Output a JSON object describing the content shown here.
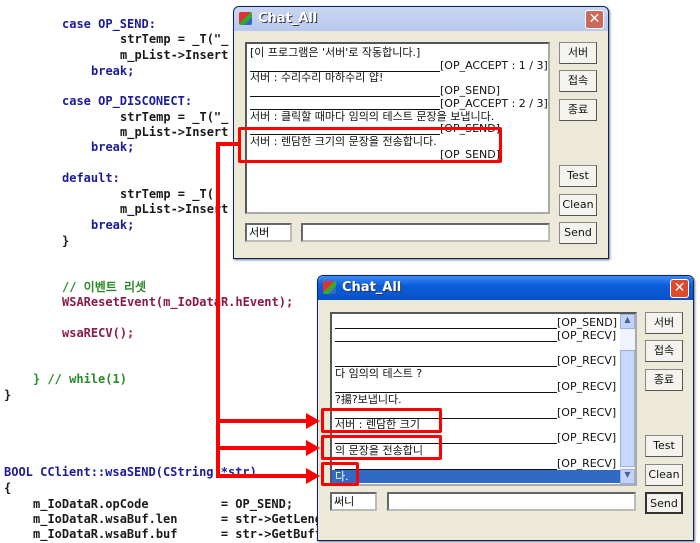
{
  "code": [
    {
      "text": "case OP_SEND:",
      "parts": [
        "case ",
        "OP_SEND",
        ":"
      ]
    },
    {
      "text": "strTemp = _T(\"_"
    },
    {
      "text": "m_pList->Insert"
    },
    {
      "text": "break;"
    },
    {
      "text": "case OP_DISCONECT:"
    },
    {
      "text": "strTemp = _T(\"_"
    },
    {
      "text": "m_pList->Insert"
    },
    {
      "text": "break;"
    },
    {
      "text": "default:"
    },
    {
      "text": "strTemp = _T("
    },
    {
      "text": "m_pList->Insert"
    },
    {
      "text": "break;"
    },
    {
      "text": "}"
    },
    {
      "text": "// 이벤트 리셋"
    },
    {
      "text": "WSAResetEvent(m_IoDataR.hEvent);"
    },
    {
      "text": "wsaRECV();"
    },
    {
      "text": "} // while(1)"
    },
    {
      "text": "}"
    },
    {
      "text": "BOOL CClient::wsaSEND(CString *str)"
    },
    {
      "text": "{"
    },
    {
      "text": "m_IoDataR.opCode          = OP_SEND;"
    },
    {
      "text": "m_IoDataR.wsaBuf.len      = str->GetLeng"
    },
    {
      "text": "m_IoDataR.wsaBuf.buf      = str->GetBuffer();"
    }
  ],
  "window1": {
    "title": "Chat_All",
    "rows": [
      {
        "text": "[이 프로그램은 '서버'로 작동합니다.]"
      },
      {
        "tag": "[OP_ACCEPT : 1 / 3]"
      },
      {
        "text": "서버 : 수리수리 마하수리 얍!"
      },
      {
        "tag": "[OP_SEND]"
      },
      {
        "tag": "[OP_ACCEPT : 2 / 3]"
      },
      {
        "text": "서버 : 클릭할 때마다 임의의 테스트 문장을 보냅니다."
      },
      {
        "tag": "[OP_SEND]"
      },
      {
        "text": "서버 : 렌담한 크기의 문장을 전송합니다."
      },
      {
        "tag": "[OP_SEND]"
      }
    ],
    "buttons": {
      "server": "서버",
      "connect": "접속",
      "exit": "종료",
      "test": "Test",
      "clean": "Clean",
      "send": "Send"
    },
    "name_value": "서버",
    "message_value": ""
  },
  "window2": {
    "title": "Chat_All",
    "rows": [
      {
        "tag": "[OP_SEND]"
      },
      {
        "tag": "[OP_RECV]"
      },
      {
        "text": ""
      },
      {
        "tag": "[OP_RECV]"
      },
      {
        "text": "다 임의의 테스트 ?"
      },
      {
        "tag": "[OP_RECV]"
      },
      {
        "text": "?揚?보냅니다."
      },
      {
        "tag": "[OP_RECV]"
      },
      {
        "text": "서버 : 렌담한 크기"
      },
      {
        "tag": "[OP_RECV]"
      },
      {
        "text": "의 문장을 전송합니"
      },
      {
        "tag": "[OP_RECV]"
      },
      {
        "text": "다.",
        "selected": true
      }
    ],
    "buttons": {
      "server": "서버",
      "connect": "접속",
      "exit": "종료",
      "test": "Test",
      "clean": "Clean",
      "send": "Send"
    },
    "name_value": "써니",
    "message_value": ""
  },
  "colors": {
    "highlight": "#ff0000",
    "selection": "#316ac5",
    "titlebar": "#0a5ddc"
  }
}
